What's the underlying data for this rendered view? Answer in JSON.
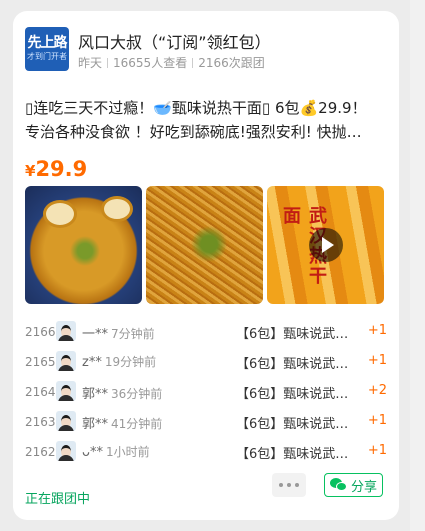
{
  "header": {
    "avatar_text": "先上路",
    "avatar_subtext": "才到门开者",
    "title": "风口大叔（“订阅”领红包）",
    "meta": {
      "time": "昨天",
      "views": "16655人查看",
      "follows": "2166次跟团"
    }
  },
  "post": {
    "line1": "▯连吃三天不过瘾！🥣甄味说热干面▯ 6包💰29.9！",
    "line2": "专治各种没食欲 ！好吃到舔碗底!强烈安利! 快抛…",
    "price_symbol": "¥",
    "price_value": "29.9",
    "photos": [
      {
        "icon": "noodle-bowl-photo"
      },
      {
        "icon": "noodles-closeup-photo"
      },
      {
        "icon": "product-package-video",
        "text": "武汉热干面"
      }
    ]
  },
  "orders": [
    {
      "rank": "2166",
      "name": "一**",
      "time": "7分钟前",
      "product": "【6包】甄味说武…",
      "count": "+1"
    },
    {
      "rank": "2165",
      "name": "z**",
      "time": "19分钟前",
      "product": "【6包】甄味说武…",
      "count": "+1"
    },
    {
      "rank": "2164",
      "name": "郭**",
      "time": "36分钟前",
      "product": "【6包】甄味说武…",
      "count": "+2"
    },
    {
      "rank": "2163",
      "name": "郭**",
      "time": "41分钟前",
      "product": "【6包】甄味说武…",
      "count": "+1"
    },
    {
      "rank": "2162",
      "name": "ᴗ**",
      "time": "1小时前",
      "product": "【6包】甄味说武…",
      "count": "+1"
    }
  ],
  "footer": {
    "status": "正在跟团中",
    "share_label": "分享"
  },
  "colors": {
    "accent_orange": "#ff6a00",
    "wechat_green": "#07c160"
  }
}
